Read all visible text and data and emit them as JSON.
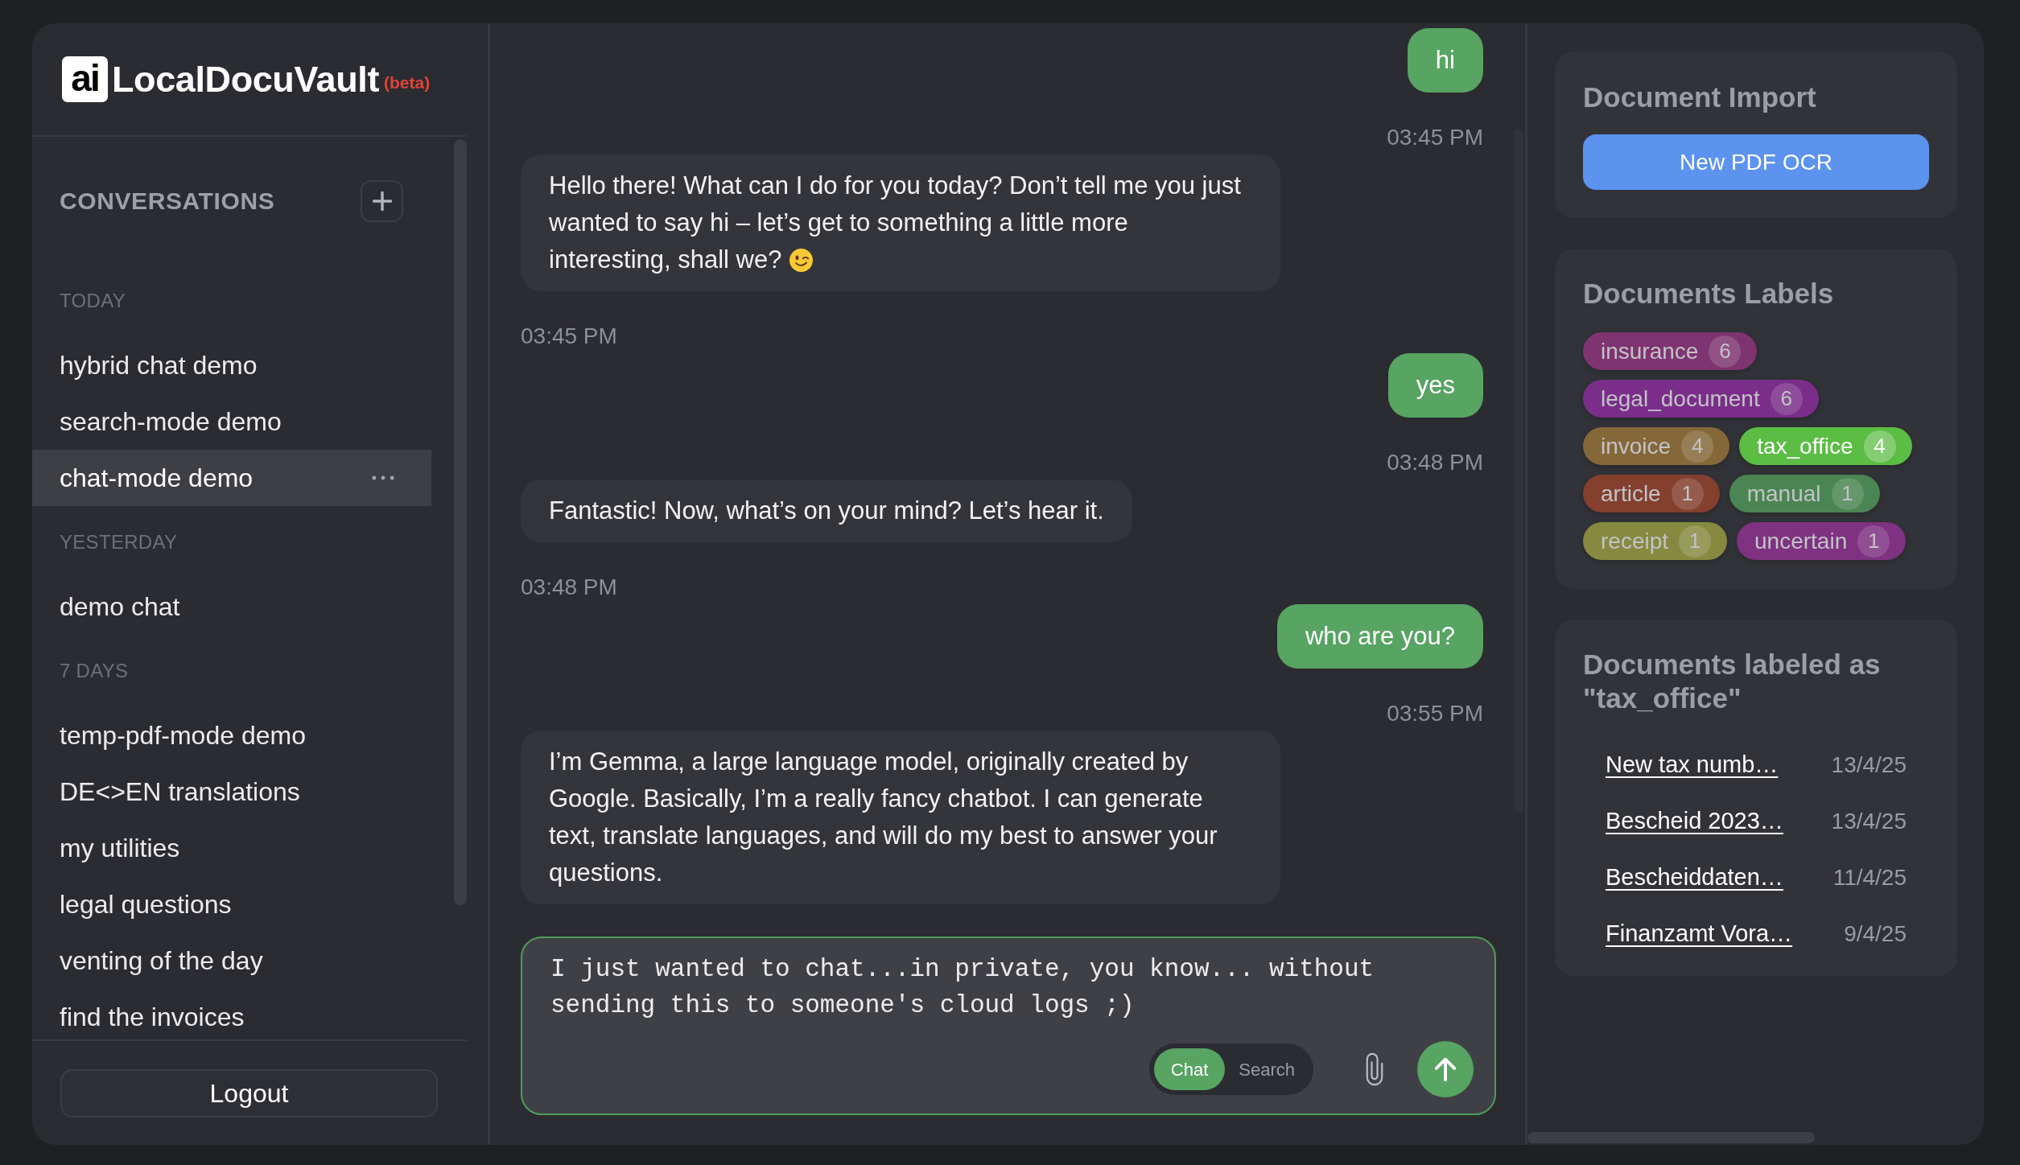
{
  "sidebar": {
    "logo": {
      "mark": "ai",
      "name": "LocalDocuVault",
      "badge": "(beta)"
    },
    "conversations_title": "CONVERSATIONS",
    "groups": [
      {
        "label": "TODAY",
        "items": [
          {
            "title": "hybrid chat demo",
            "selected": false
          },
          {
            "title": "search-mode demo",
            "selected": false
          },
          {
            "title": "chat-mode demo",
            "selected": true
          }
        ]
      },
      {
        "label": "YESTERDAY",
        "items": [
          {
            "title": "demo chat",
            "selected": false
          }
        ]
      },
      {
        "label": "7 DAYS",
        "items": [
          {
            "title": "temp-pdf-mode demo",
            "selected": false
          },
          {
            "title": "DE<>EN translations",
            "selected": false
          },
          {
            "title": "my utilities",
            "selected": false
          },
          {
            "title": "legal questions",
            "selected": false
          },
          {
            "title": "venting of the day",
            "selected": false
          },
          {
            "title": "find the invoices",
            "selected": false
          }
        ]
      }
    ],
    "logout_button": "Logout"
  },
  "chat": {
    "messages": [
      {
        "kind": "user",
        "text": "hi",
        "time": "03:45 PM"
      },
      {
        "kind": "assistant",
        "text": "Hello there! What can I do for you today? Don’t tell me you just wanted to say hi – let’s get to something a little more interesting, shall we?",
        "emoji": true,
        "time": "03:45 PM"
      },
      {
        "kind": "user",
        "text": "yes",
        "time": "03:48 PM"
      },
      {
        "kind": "assistant",
        "text": "Fantastic! Now, what’s on your mind? Let’s hear it.",
        "time": "03:48 PM"
      },
      {
        "kind": "user",
        "text": "who are you?",
        "time": "03:55 PM"
      },
      {
        "kind": "assistant",
        "text": "I’m Gemma, a large language model, originally created by Google. Basically, I’m a really fancy chatbot. I can generate text, translate languages, and will do my best to answer your questions."
      }
    ],
    "composer": {
      "value": "I just wanted to chat...in private, you know... without sending this to someone's cloud logs ;)",
      "modes": [
        {
          "label": "Chat",
          "selected": true
        },
        {
          "label": "Search",
          "selected": false
        }
      ]
    }
  },
  "right_panel": {
    "import": {
      "title": "Document Import",
      "button": "New PDF OCR"
    },
    "labels": {
      "title": "Documents Labels",
      "tags": [
        {
          "name": "insurance",
          "count": "6",
          "color": "#7e3470",
          "selected": false
        },
        {
          "name": "legal_document",
          "count": "6",
          "color": "#7a2e89",
          "selected": false
        },
        {
          "name": "invoice",
          "count": "4",
          "color": "#856839",
          "selected": false
        },
        {
          "name": "tax_office",
          "count": "4",
          "color": "#5cbd45",
          "selected": true
        },
        {
          "name": "article",
          "count": "1",
          "color": "#843f2e",
          "selected": false
        },
        {
          "name": "manual",
          "count": "1",
          "color": "#4b8553",
          "selected": false
        },
        {
          "name": "receipt",
          "count": "1",
          "color": "#858a40",
          "selected": false
        },
        {
          "name": "uncertain",
          "count": "1",
          "color": "#7e3281",
          "selected": false
        }
      ]
    },
    "labeled_documents": {
      "title": "Documents labeled as \"tax_office\"",
      "documents": [
        {
          "title": "New tax numb…",
          "date": "13/4/25"
        },
        {
          "title": "Bescheid 2023…",
          "date": "13/4/25"
        },
        {
          "title": "Bescheiddaten…",
          "date": "11/4/25"
        },
        {
          "title": "Finanzamt Vora…",
          "date": "9/4/25"
        }
      ]
    }
  }
}
